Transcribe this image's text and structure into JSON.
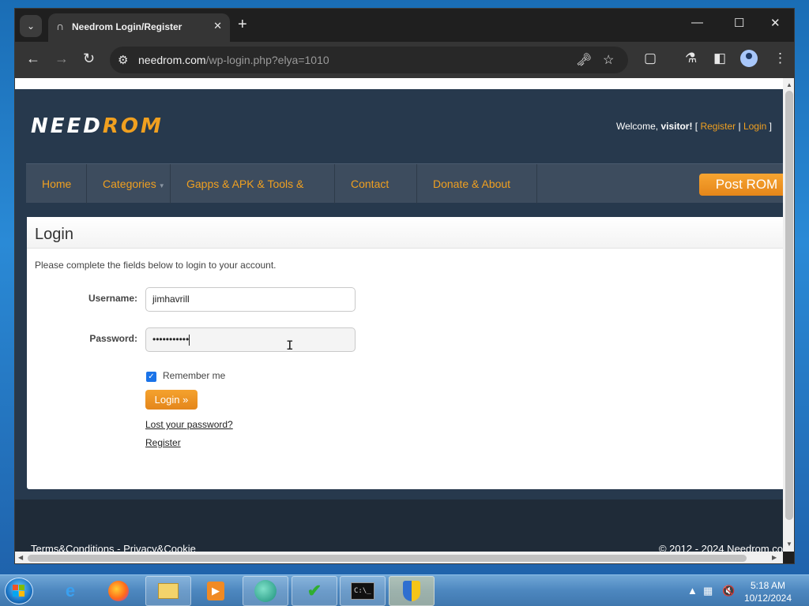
{
  "browser": {
    "tab": {
      "title": "Needrom Login/Register",
      "favicon": "needrom-icon"
    },
    "address": {
      "host": "needrom.com",
      "path": "/wp-login.php?elya=1010"
    }
  },
  "site": {
    "logo": {
      "part1": "NEED",
      "part2": "ROM"
    },
    "welcome": {
      "prefix": "Welcome, ",
      "user": "visitor!",
      "open": " [ ",
      "register": "Register",
      "sep": " | ",
      "login": "Login",
      "close": " ]"
    },
    "nav": [
      "Home",
      "Categories",
      "Gapps & APK & Tools & Tuto",
      "Contact us",
      "Donate & About us"
    ],
    "post_rom": "Post ROM"
  },
  "login": {
    "title": "Login",
    "intro": "Please complete the fields below to login to your account.",
    "username_label": "Username:",
    "username_value": "jimhavrill",
    "password_label": "Password:",
    "password_value": "•••••••••••",
    "remember_label": "Remember me",
    "remember_checked": true,
    "button": "Login »",
    "lost_password": "Lost your password?",
    "register": "Register"
  },
  "footer": {
    "terms": "Terms&Conditions",
    "sep": " - ",
    "privacy": "Privacy&Cookie",
    "copyright": "© 2012 - 2024 Needrom.co"
  },
  "taskbar": {
    "apps": [
      "internet-explorer-icon",
      "firefox-icon",
      "file-explorer-icon",
      "media-player-icon",
      "browser-icon",
      "task-checklist-icon",
      "command-prompt-icon",
      "security-shield-icon"
    ],
    "time": "5:18 AM",
    "date": "10/12/2024"
  },
  "colors": {
    "accent": "#f0a020",
    "header": "#27394d",
    "nav": "#3d4c5e"
  }
}
